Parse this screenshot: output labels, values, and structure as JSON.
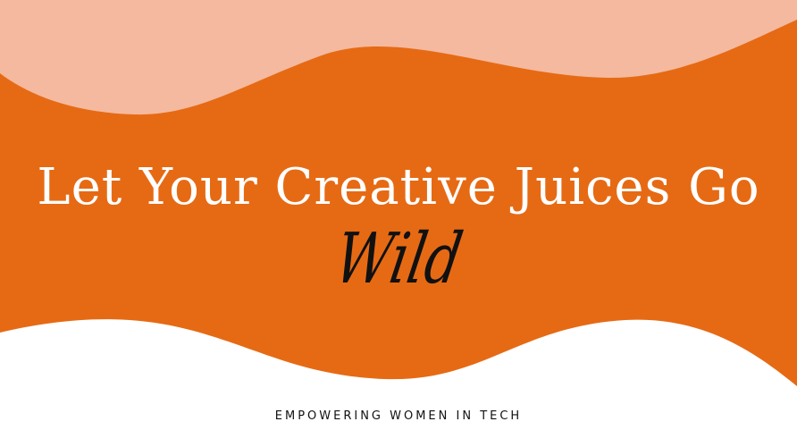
{
  "banner": {
    "headline": "Let Your Creative Juices Go",
    "script_word": "Wild",
    "tagline": "EMPOWERING WOMEN IN TECH"
  },
  "colors": {
    "orange": "#e66a14",
    "peach": "#f4b99e",
    "white": "#ffffff",
    "ink": "#111111"
  }
}
